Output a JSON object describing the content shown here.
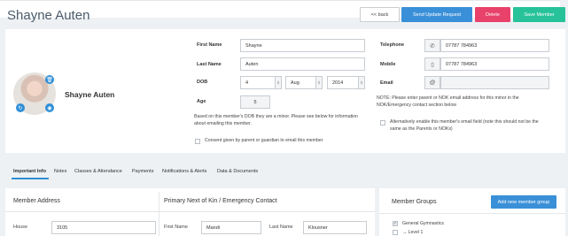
{
  "header": {
    "title": "Shayne Auten",
    "buttons": {
      "back": "<< back",
      "send_update": "Send Update Request",
      "delete": "Delete",
      "save": "Save Member"
    }
  },
  "profile": {
    "name": "Shayne Auten"
  },
  "form": {
    "first_name": {
      "label": "First Name",
      "value": "Shayne"
    },
    "last_name": {
      "label": "Last Name",
      "value": "Auten"
    },
    "dob": {
      "label": "DOB",
      "day": "4",
      "month": "Aug",
      "year": "2014"
    },
    "age": {
      "label": "Age",
      "value": "5"
    },
    "minor_note": "Based on this member's DOB they are a minor. Please see below for information about emailing this member.",
    "consent_label": "Consent given by parent or guardian to email this member",
    "telephone": {
      "label": "Telephone",
      "value": "07787 784963"
    },
    "mobile": {
      "label": "Mobile",
      "value": "07787 784963"
    },
    "email": {
      "label": "Email",
      "value": ""
    },
    "email_note": "NOTE: Please enter parent or NOK email address for this minor in the NOK/Emergency contact section below",
    "alt_email_label": "Alternatively enable this member's email field (note this should not be the same as the Parents or NOKs)"
  },
  "tabs": [
    {
      "label": "Important Info",
      "active": true
    },
    {
      "label": "Notes"
    },
    {
      "label": "Classes & Attendance"
    },
    {
      "label": "Payments"
    },
    {
      "label": "Notifications & Alerts"
    },
    {
      "label": "Data & Documents"
    }
  ],
  "address": {
    "title": "Member Address",
    "house_label": "House",
    "house_value": "3105"
  },
  "nok": {
    "title": "Primary Next of Kin / Emergency Contact",
    "first_name_label": "First Name",
    "first_name_value": "Mandi",
    "last_name_label": "Last Name",
    "last_name_value": "Klousner"
  },
  "groups": {
    "title": "Member Groups",
    "add_button": "Add new member group",
    "items": [
      {
        "label": "General Gymnastics",
        "checked": true
      },
      {
        "label": "→ Level 1",
        "checked": false
      }
    ]
  },
  "icons": {
    "trash": "trash-icon",
    "refresh": "refresh-icon",
    "camera": "camera-icon",
    "phone": "phone-icon",
    "mobile": "mobile-icon",
    "at": "at-icon"
  },
  "colors": {
    "primary": "#3a90d8",
    "danger": "#e8416a",
    "success": "#27c29a"
  }
}
